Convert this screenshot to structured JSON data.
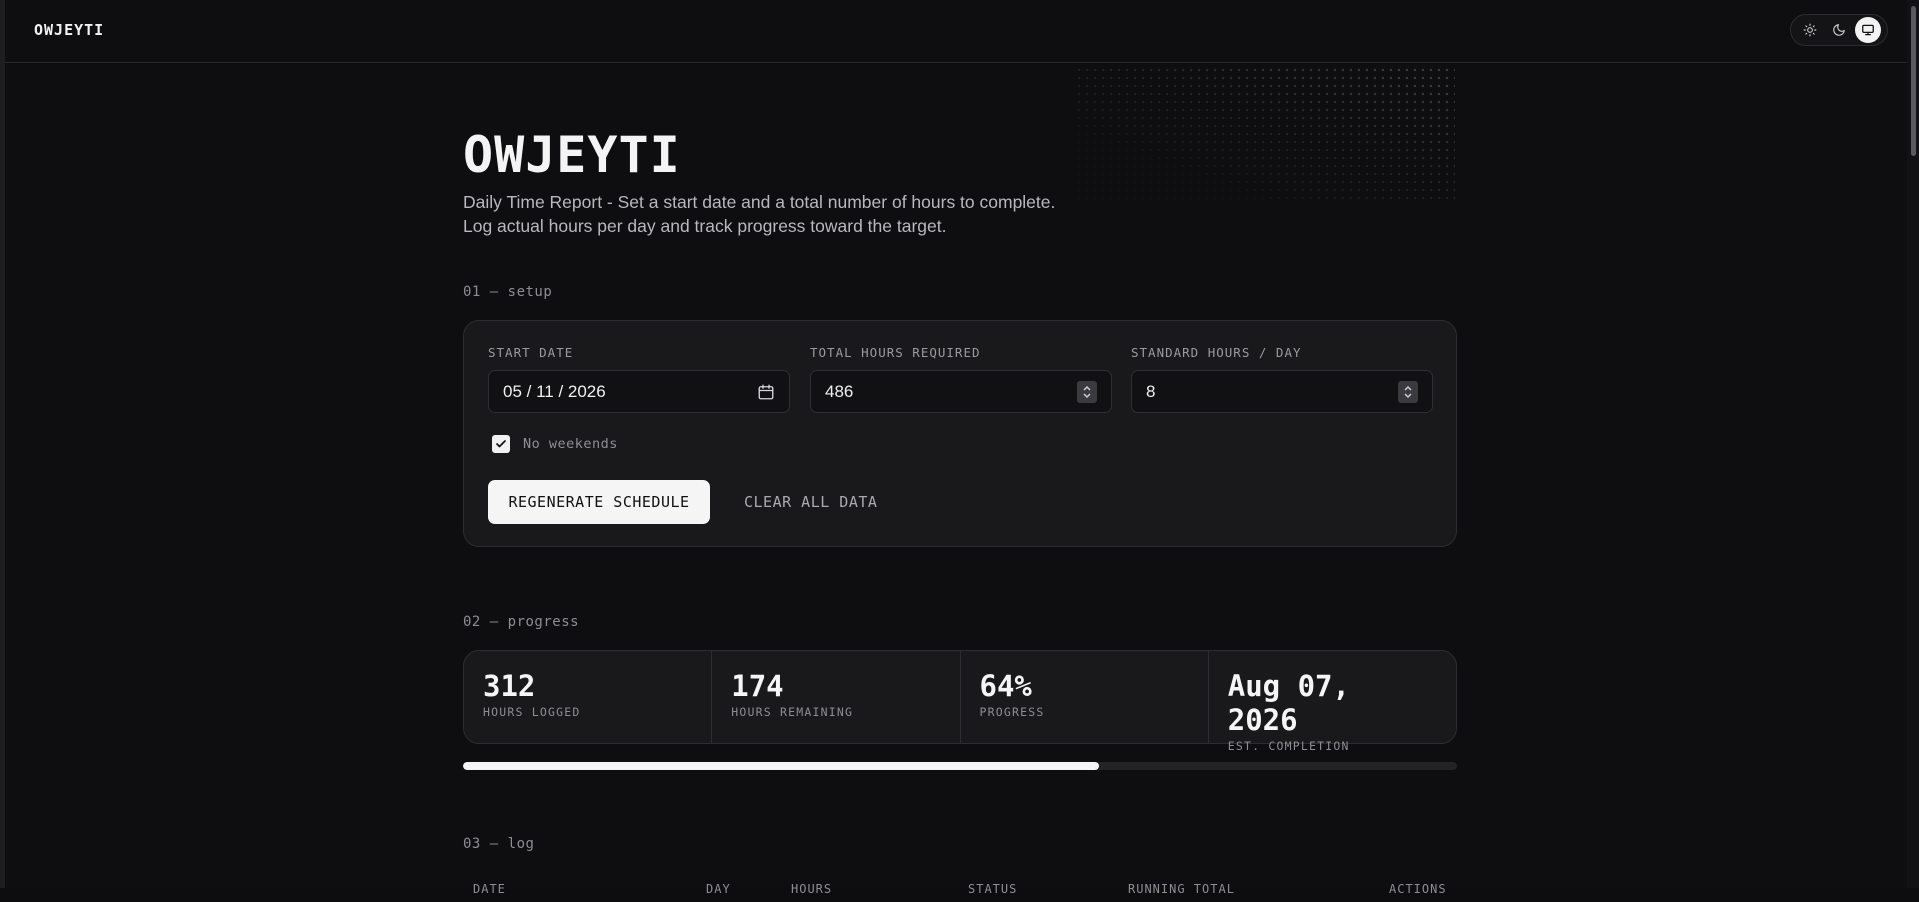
{
  "header": {
    "brand": "OWJEYTI",
    "theme_options": [
      "light-icon",
      "dark-icon",
      "system-icon"
    ],
    "theme_active": "system"
  },
  "hero": {
    "title": "OWJEYTI",
    "subtitle": "Daily Time Report - Set a start date and a total number of hours to complete. Log actual hours per day and track progress toward the target."
  },
  "setup": {
    "section_label": "01 — setup",
    "start_date_label": "START DATE",
    "start_date_value": "05 / 11 / 2026",
    "total_hours_label": "TOTAL HOURS REQUIRED",
    "total_hours_value": "486",
    "standard_hours_label": "STANDARD HOURS / DAY",
    "standard_hours_value": "8",
    "no_weekends_label": "No weekends",
    "no_weekends_checked": true,
    "regenerate_label": "REGENERATE SCHEDULE",
    "clear_label": "CLEAR ALL DATA"
  },
  "progress": {
    "section_label": "02 — progress",
    "hours_logged": "312",
    "hours_logged_label": "HOURS LOGGED",
    "hours_remaining": "174",
    "hours_remaining_label": "HOURS REMAINING",
    "progress_value": "64%",
    "progress_label": "PROGRESS",
    "progress_fraction": 0.64,
    "est_completion": "Aug 07, 2026",
    "est_completion_label": "EST. COMPLETION"
  },
  "log": {
    "section_label": "03 — log",
    "columns": [
      "DATE",
      "DAY",
      "HOURS",
      "STATUS",
      "RUNNING TOTAL",
      "ACTIONS"
    ]
  },
  "colors": {
    "background": "#0e0e10",
    "card": "#19191b",
    "accent": "#f5f5f5"
  }
}
